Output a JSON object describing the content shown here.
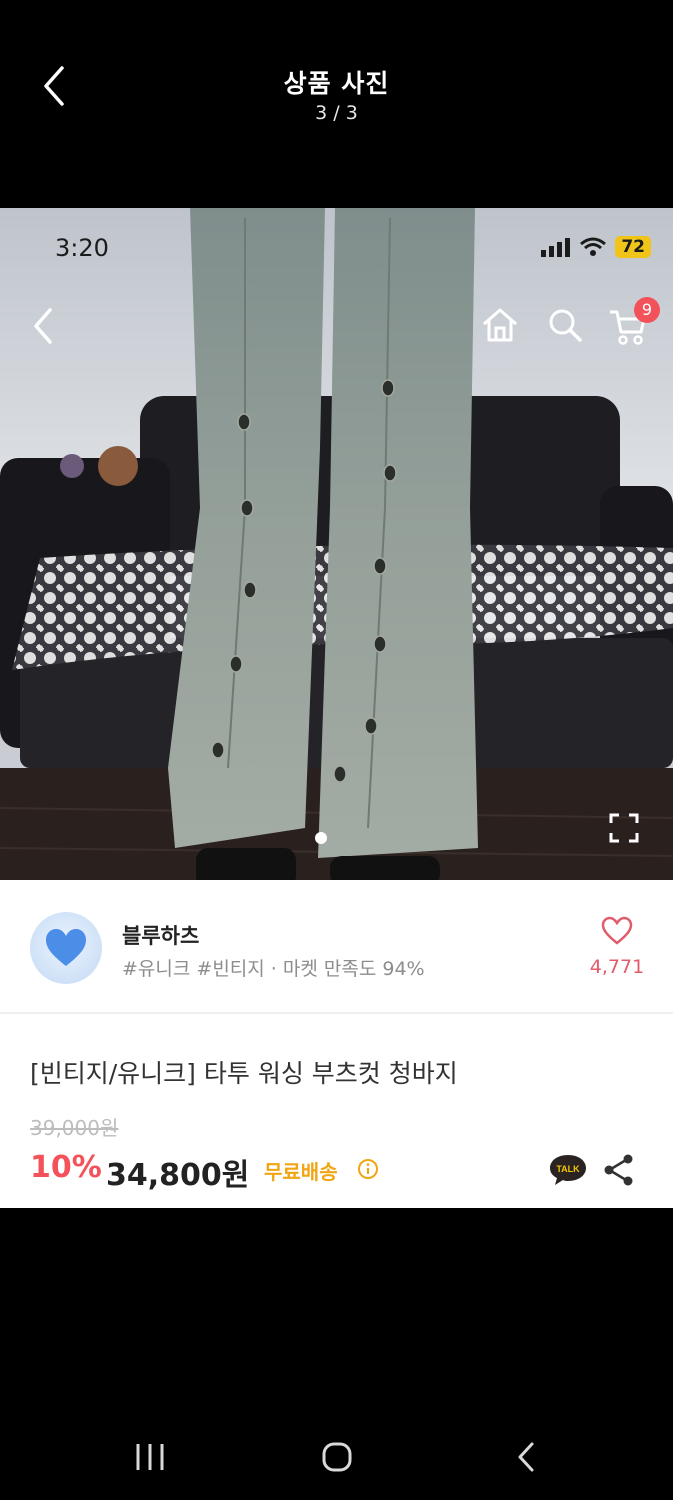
{
  "viewer": {
    "title": "상품 사진",
    "counter": "3 / 3"
  },
  "screenshot": {
    "status_time": "3:20",
    "battery": "72",
    "cart_badge": "9"
  },
  "shop": {
    "name": "블루하츠",
    "tags": "#유니크 #빈티지 · 마켓 만족도 94%",
    "likes": "4,771"
  },
  "product": {
    "name": "[빈티지/유니크] 타투 워싱 부츠컷 청바지",
    "original_price": "39,000원",
    "discount": "10%",
    "price": "34,800원",
    "shipping": "무료배송",
    "talk_label": "TALK"
  },
  "colors": {
    "accent": "#f4525b",
    "shipping": "#f1a514",
    "background": "#000000"
  },
  "icons": {
    "back": "chevron-left-icon",
    "home": "home-icon",
    "search": "search-icon",
    "cart": "cart-icon",
    "fullscreen": "expand-icon",
    "like": "heart-icon",
    "talk": "kakaotalk-icon",
    "share": "share-icon",
    "info": "info-icon"
  }
}
